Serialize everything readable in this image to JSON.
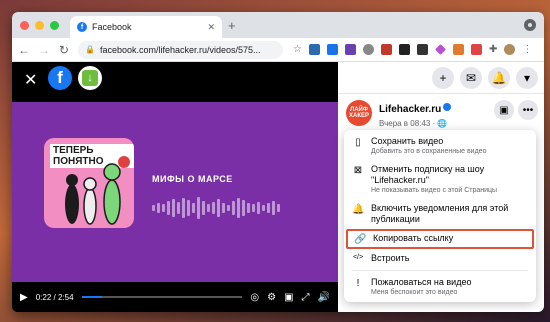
{
  "browser": {
    "tab_title": "Facebook",
    "tab_favicon": "f",
    "tab_close": "✕",
    "new_tab": "+",
    "url": "facebook.com/lifehacker.ru/videos/575...",
    "back": "←",
    "forward": "→",
    "reload": "↻",
    "lock": "🔒"
  },
  "viewer": {
    "close": "✕",
    "fb_logo": "f",
    "download": "↓"
  },
  "video": {
    "thumbnail_title": "ТЕПЕРЬ ПОНЯТНО",
    "title": "МИФЫ О МАРСЕ",
    "play": "▶",
    "time": "0:22 / 2:54",
    "progress": 0.13
  },
  "page": {
    "avatar_text": "ЛАЙФ ХАКЕР",
    "name": "Lifehacker.ru",
    "meta": "Вчера в 08:43 · 🌐"
  },
  "side_top": {
    "add": "+",
    "messenger": "✉",
    "notifications": "🔔",
    "account": "▾"
  },
  "menu": {
    "items": [
      {
        "icon": "▯",
        "label": "Сохранить видео",
        "sub": "Добавить это в сохраненные видео"
      },
      {
        "icon": "⊠",
        "label": "Отменить подписку на шоу \"Lifehacker.ru\"",
        "sub": "Не показывать видео с этой Страницы"
      },
      {
        "icon": "🔔",
        "label": "Включить уведомления для этой публикации",
        "sub": ""
      },
      {
        "icon": "🔗",
        "label": "Копировать ссылку",
        "sub": ""
      },
      {
        "icon": "</>",
        "label": "Встроить",
        "sub": ""
      },
      {
        "icon": "!",
        "label": "Пожаловаться на видео",
        "sub": "Меня беспокоит это видео"
      }
    ]
  },
  "colors": {
    "accent": "#1877f2",
    "highlight": "#e0533b",
    "video_bg": "#7a2fa6"
  }
}
